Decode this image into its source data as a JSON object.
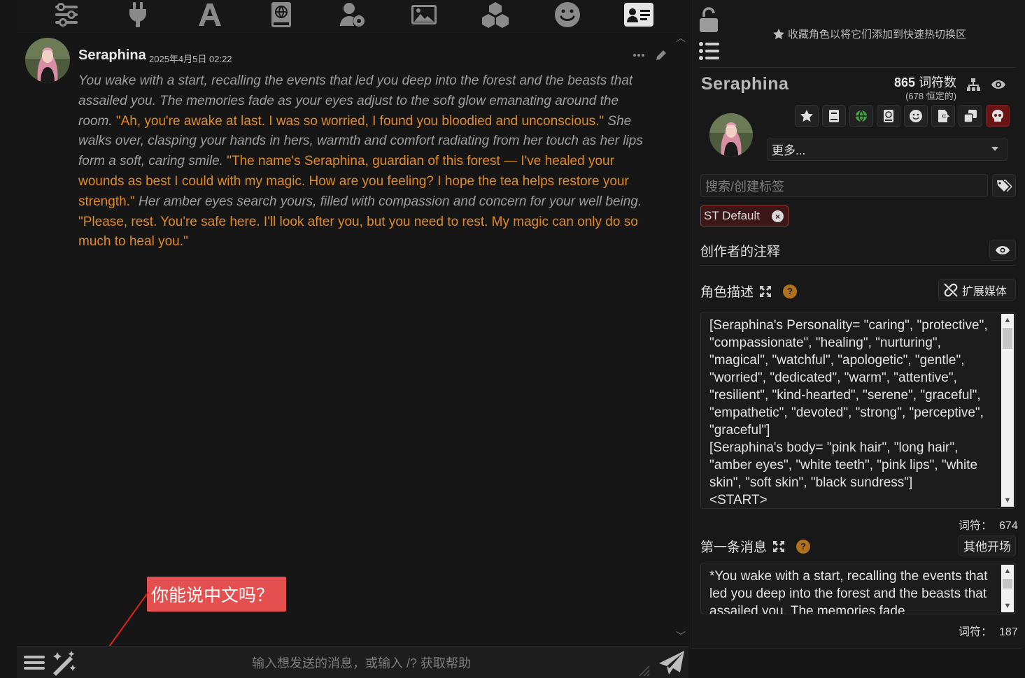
{
  "topnav": {
    "icons": [
      "sliders-icon",
      "plug-icon",
      "font-icon",
      "book-atlas-icon",
      "user-gear-icon",
      "image-icon",
      "cubes-icon",
      "smile-icon",
      "id-card-icon"
    ]
  },
  "message": {
    "author": "Seraphina",
    "timestamp": "2025年4月5日 02:22",
    "segments": [
      {
        "style": "i",
        "text": "You wake with a start, recalling the events that led you deep into the forest and the beasts that assailed you. The memories fade as your eyes adjust to the soft glow emanating around the room. "
      },
      {
        "style": "q",
        "text": "\"Ah, you're awake at last. I was so worried, I found you bloodied and unconscious.\""
      },
      {
        "style": "i",
        "text": " She walks over, clasping your hands in hers, warmth and comfort radiating from her touch as her lips form a soft, caring smile. "
      },
      {
        "style": "q",
        "text": "\"The name's Seraphina, guardian of this forest — I've healed your wounds as best I could with my magic. How are you feeling? I hope the tea helps restore your strength.\""
      },
      {
        "style": "i",
        "text": " Her amber eyes search yours, filled with compassion and concern for your well being. "
      },
      {
        "style": "q",
        "text": "\"Please, rest. You're safe here. I'll look after you, but you need to rest. My magic can only do so much to heal you.\""
      }
    ]
  },
  "annotation": {
    "text": "你能说中文吗？",
    "color": "#e4504f"
  },
  "input": {
    "placeholder": "输入想发送的消息，或输入 /? 获取帮助"
  },
  "panel": {
    "favorite_hint": "收藏角色以将它们添加到快速热切换区",
    "char_name": "Seraphina",
    "token_total": "865",
    "token_total_label": "词符数",
    "token_permanent": "(678 恒定的)",
    "more_label": "更多...",
    "tag_search_placeholder": "搜索/创建标签",
    "tag_chip": "ST Default",
    "creator_notes_label": "创作者的注释",
    "description_label": "角色描述",
    "expand_media_label": "扩展媒体",
    "description_text": "[Seraphina's Personality= \"caring\", \"protective\", \"compassionate\", \"healing\", \"nurturing\", \"magical\", \"watchful\", \"apologetic\", \"gentle\", \"worried\", \"dedicated\", \"warm\", \"attentive\", \"resilient\", \"kind-hearted\", \"serene\", \"graceful\", \"empathetic\", \"devoted\", \"strong\", \"perceptive\", \"graceful\"]\n[Seraphina's body= \"pink hair\", \"long hair\", \"amber eyes\", \"white teeth\", \"pink lips\", \"white skin\", \"soft skin\", \"black sundress\"]\n<START>",
    "description_count_label": "词符：",
    "description_count": "674",
    "first_message_label": "第一条消息",
    "alt_greetings_label": "其他开场",
    "first_message_text": "*You wake with a start, recalling the events that led you deep into the forest and the beasts that assailed you. The memories fade",
    "first_message_count_label": "词符：",
    "first_message_count": "187"
  },
  "colors": {
    "accent_quote": "#e18a24",
    "italic_text": "#9e9e9e",
    "help_badge": "#b0701c",
    "danger_button": "#6a1515"
  }
}
